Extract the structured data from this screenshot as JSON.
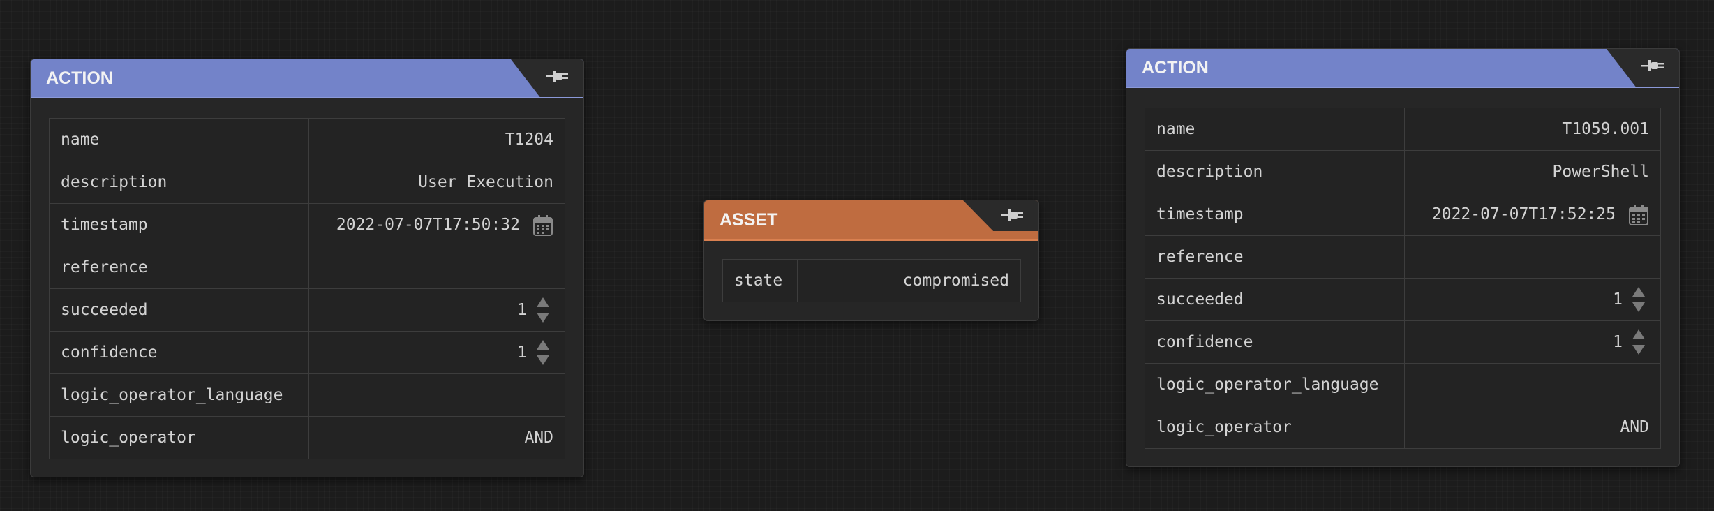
{
  "nodes": {
    "action1": {
      "title": "ACTION",
      "accent": "#7383c9",
      "icon": "plug-icon",
      "rows": {
        "name": {
          "key": "name",
          "value": "T1204"
        },
        "description": {
          "key": "description",
          "value": "User Execution"
        },
        "timestamp": {
          "key": "timestamp",
          "value": "2022-07-07T17:50:32",
          "icon": "calendar-icon"
        },
        "reference": {
          "key": "reference",
          "value": ""
        },
        "succeeded": {
          "key": "succeeded",
          "value": "1"
        },
        "confidence": {
          "key": "confidence",
          "value": "1"
        },
        "logic_operator_language": {
          "key": "logic_operator_language",
          "value": ""
        },
        "logic_operator": {
          "key": "logic_operator",
          "value": "AND"
        }
      }
    },
    "asset": {
      "title": "ASSET",
      "accent": "#bf6c40",
      "icon": "plug-icon",
      "rows": {
        "state": {
          "key": "state",
          "value": "compromised"
        }
      }
    },
    "action2": {
      "title": "ACTION",
      "accent": "#7383c9",
      "icon": "plug-icon",
      "rows": {
        "name": {
          "key": "name",
          "value": "T1059.001"
        },
        "description": {
          "key": "description",
          "value": "PowerShell"
        },
        "timestamp": {
          "key": "timestamp",
          "value": "2022-07-07T17:52:25",
          "icon": "calendar-icon"
        },
        "reference": {
          "key": "reference",
          "value": ""
        },
        "succeeded": {
          "key": "succeeded",
          "value": "1"
        },
        "confidence": {
          "key": "confidence",
          "value": "1"
        },
        "logic_operator_language": {
          "key": "logic_operator_language",
          "value": ""
        },
        "logic_operator": {
          "key": "logic_operator",
          "value": "AND"
        }
      }
    }
  }
}
